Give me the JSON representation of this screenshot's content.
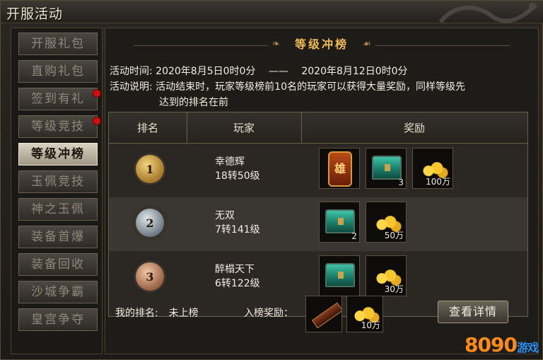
{
  "window": {
    "title": "开服活动"
  },
  "sidebar": {
    "items": [
      {
        "label": "开服礼包",
        "active": false,
        "dot": false
      },
      {
        "label": "直购礼包",
        "active": false,
        "dot": false
      },
      {
        "label": "签到有礼",
        "active": false,
        "dot": true
      },
      {
        "label": "等级竞技",
        "active": false,
        "dot": true
      },
      {
        "label": "等级冲榜",
        "active": true,
        "dot": false
      },
      {
        "label": "玉佩竞技",
        "active": false,
        "dot": false
      },
      {
        "label": "神之玉佩",
        "active": false,
        "dot": false
      },
      {
        "label": "装备首爆",
        "active": false,
        "dot": false
      },
      {
        "label": "装备回收",
        "active": false,
        "dot": false
      },
      {
        "label": "沙城争霸",
        "active": false,
        "dot": false
      },
      {
        "label": "皇宫争夺",
        "active": false,
        "dot": false
      }
    ]
  },
  "panel": {
    "title": "等级冲榜",
    "time_label": "活动时间:",
    "time_start": "2020年8月5日0时0分",
    "time_sep": "——",
    "time_end": "2020年8月12日0时0分",
    "desc_label": "活动说明:",
    "desc_line1": "活动结束时，玩家等级榜前10名的玩家可以获得大量奖励，同样等级先",
    "desc_line2": "达到的排名在前"
  },
  "table": {
    "headers": {
      "rank": "排名",
      "player": "玩家",
      "reward": "奖励"
    },
    "rows": [
      {
        "rank": "1",
        "name": "幸德辉",
        "level": "18转50级",
        "rewards": [
          {
            "icon": "title-badge-icon",
            "label": "雄",
            "count": ""
          },
          {
            "icon": "jade-chest-icon",
            "count": "3"
          },
          {
            "icon": "gold-coins-icon",
            "count": "100万"
          }
        ]
      },
      {
        "rank": "2",
        "name": "无双",
        "level": "7转141级",
        "rewards": [
          {
            "icon": "jade-chest-icon",
            "count": "2"
          },
          {
            "icon": "gold-coins-icon",
            "count": "50万"
          }
        ]
      },
      {
        "rank": "3",
        "name": "醉榻天下",
        "level": "6转122级",
        "rewards": [
          {
            "icon": "jade-chest-icon",
            "count": ""
          },
          {
            "icon": "gold-coins-icon",
            "count": "30万"
          }
        ]
      }
    ]
  },
  "footer": {
    "my_rank_label": "我的排名:",
    "my_rank_value": "未上榜",
    "entry_reward_label": "入榜奖励：",
    "entry_rewards": [
      {
        "icon": "scroll-icon",
        "count": ""
      },
      {
        "icon": "gold-coins-icon",
        "count": "10万"
      }
    ],
    "details_button": "查看详情"
  },
  "watermark": {
    "text": "8090",
    "suffix": "游戏"
  }
}
